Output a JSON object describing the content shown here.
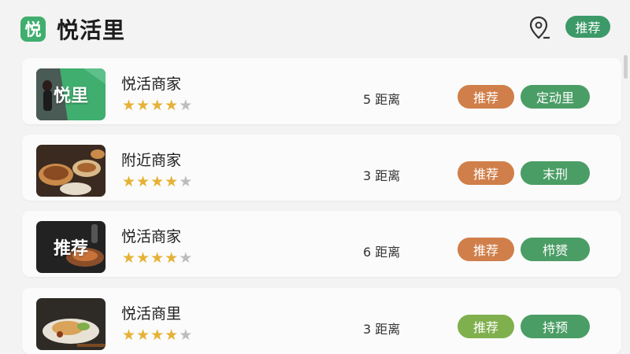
{
  "header": {
    "logo_char": "悦",
    "title": "悦活里",
    "location_icon": "map-pin-icon",
    "recommend_label": "推荐",
    "colors": {
      "brand": "#3fae6e",
      "pill": "#3c9a68"
    }
  },
  "list": [
    {
      "thumb_text": "悦里",
      "name": "悦活商家",
      "rating": 4,
      "max_rating": 5,
      "distance": "5 距离",
      "tag1": "推荐",
      "tag1_color": "#d07f4a",
      "tag2": "定动里"
    },
    {
      "thumb_text": "",
      "name": "附近商家",
      "rating": 4,
      "max_rating": 5,
      "distance": "3 距离",
      "tag1": "推荐",
      "tag1_color": "#d07f4a",
      "tag2": "末刑"
    },
    {
      "thumb_text": "推荐",
      "name": "悦活商家",
      "rating": 4,
      "max_rating": 5,
      "distance": "6 距离",
      "tag1": "推荐",
      "tag1_color": "#d07f4a",
      "tag2": "栉赟"
    },
    {
      "thumb_text": "",
      "name": "悦活商里",
      "rating": 4,
      "max_rating": 5,
      "distance": "3 距离",
      "tag1": "推荐",
      "tag1_color": "#7fb04d",
      "tag2": "持预"
    }
  ]
}
